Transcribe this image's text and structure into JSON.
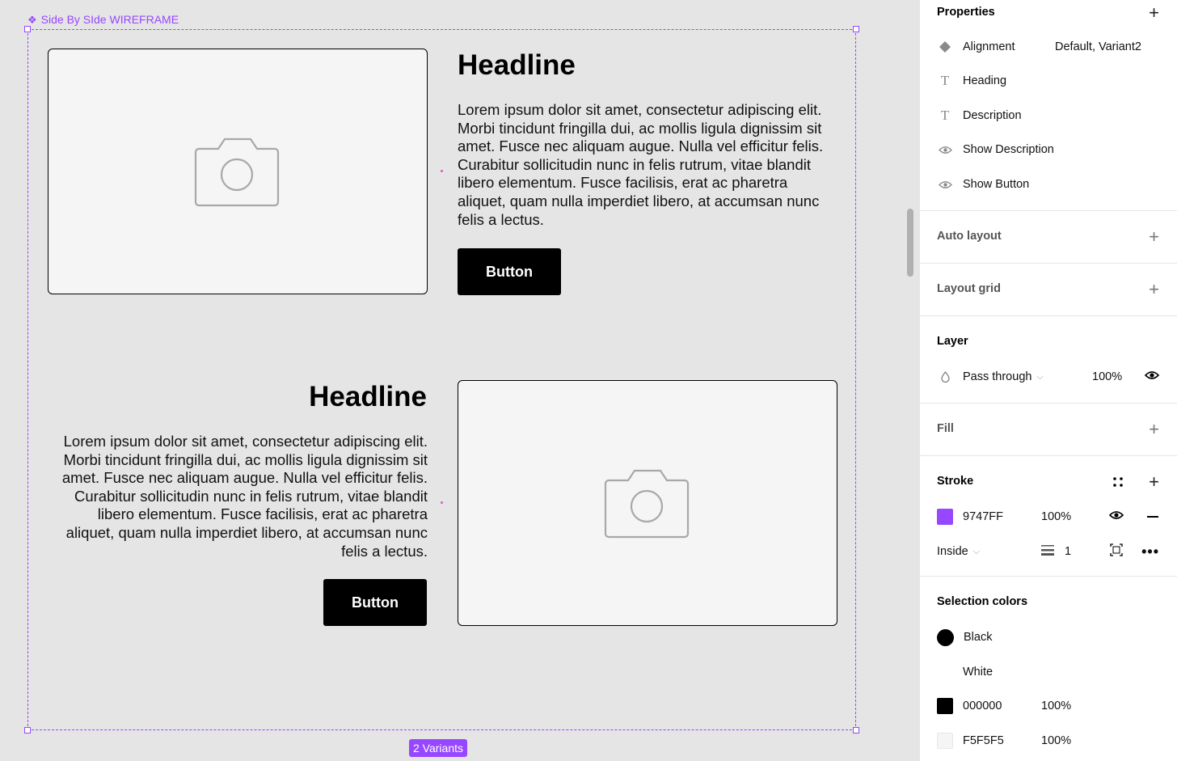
{
  "canvas": {
    "frame_label": "Side By SIde WIREFRAME",
    "variants_badge": "2 Variants",
    "variant1": {
      "headline": "Headline",
      "description": "Lorem ipsum dolor sit amet, consectetur adipiscing elit. Morbi tincidunt fringilla dui, ac mollis ligula dignissim sit amet. Fusce nec aliquam augue. Nulla vel efficitur felis. Curabitur sollicitudin nunc in felis rutrum, vitae blandit libero elementum. Fusce facilisis, erat ac pharetra aliquet, quam nulla imperdiet libero, at accumsan nunc felis a lectus.",
      "button": "Button"
    },
    "variant2": {
      "headline": "Headline",
      "description": "Lorem ipsum dolor sit amet, consectetur adipiscing elit. Morbi tincidunt fringilla dui, ac mollis ligula dignissim sit amet. Fusce nec aliquam augue. Nulla vel efficitur felis. Curabitur sollicitudin nunc in felis rutrum, vitae blandit libero elementum. Fusce facilisis, erat ac pharetra aliquet, quam nulla imperdiet libero, at accumsan nunc felis a lectus.",
      "button": "Button"
    },
    "colors": {
      "stroke": "#9747FF",
      "placeholder_fill": "#F5F5F5",
      "canvas_bg": "#E5E5E5"
    }
  },
  "panel": {
    "properties": {
      "title": "Properties",
      "items": [
        {
          "label": "Alignment",
          "value": "Default, Variant2",
          "icon": "variant-diamond-icon"
        },
        {
          "label": "Heading",
          "icon": "text-icon"
        },
        {
          "label": "Description",
          "icon": "text-icon"
        },
        {
          "label": "Show Description",
          "icon": "eye-icon"
        },
        {
          "label": "Show Button",
          "icon": "eye-icon"
        }
      ]
    },
    "auto_layout": {
      "title": "Auto layout"
    },
    "layout_grid": {
      "title": "Layout grid"
    },
    "layer": {
      "title": "Layer",
      "blend": "Pass through",
      "opacity": "100%"
    },
    "fill": {
      "title": "Fill"
    },
    "stroke": {
      "title": "Stroke",
      "color_hex": "9747FF",
      "opacity": "100%",
      "position": "Inside",
      "weight": "1"
    },
    "selection_colors": {
      "title": "Selection colors",
      "items": [
        {
          "label": "Black",
          "color": "#000000"
        },
        {
          "label": "White",
          "color": "#FFFFFF"
        },
        {
          "label": "000000",
          "opacity": "100%",
          "color": "#000000"
        },
        {
          "label": "F5F5F5",
          "opacity": "100%",
          "color": "#F5F5F5"
        }
      ]
    }
  }
}
